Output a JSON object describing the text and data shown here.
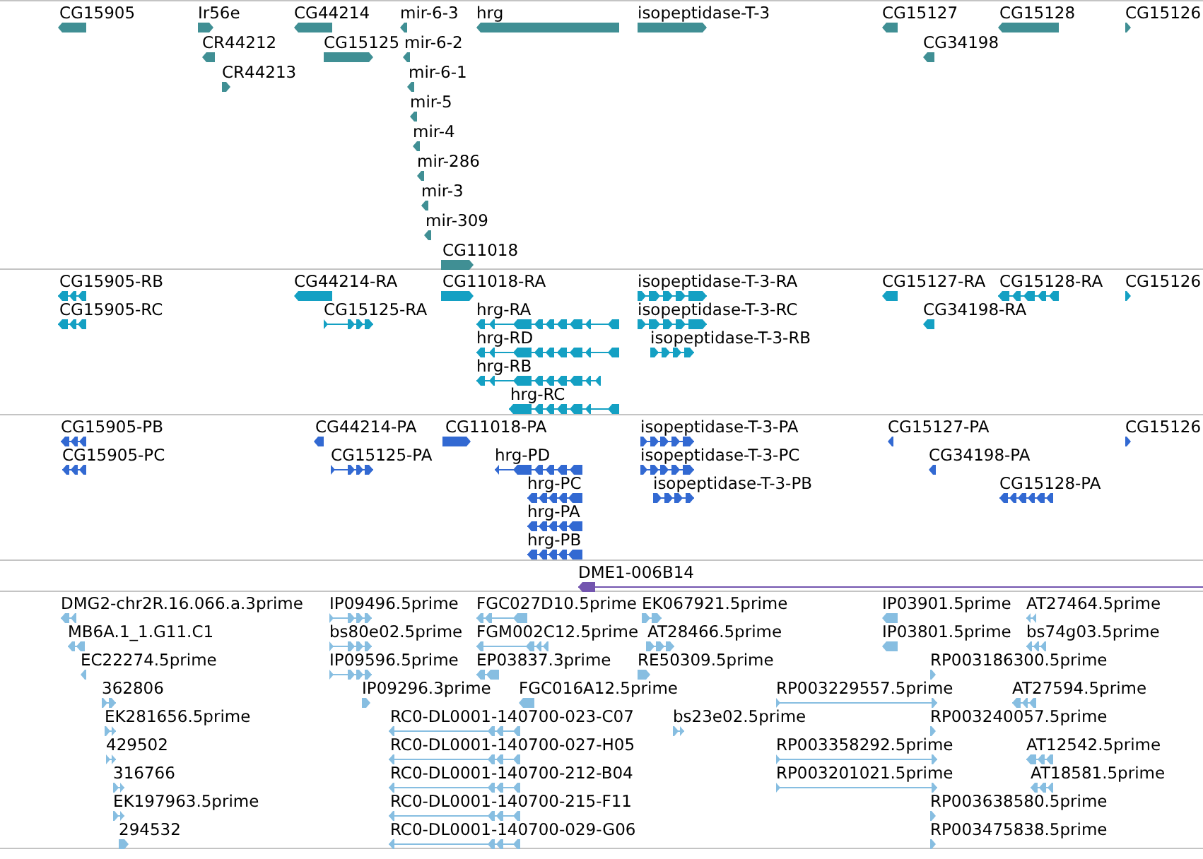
{
  "tracks": [
    {
      "color": "#408f94",
      "features": [
        {
          "label": "CG15905",
          "reverse": true
        },
        {
          "label": "Ir56e",
          "reverse": false
        },
        {
          "label": "CG44214",
          "reverse": true
        },
        {
          "label": "mir-6-3",
          "reverse": true
        },
        {
          "label": "hrg",
          "reverse": true
        },
        {
          "label": "isopeptidase-T-3",
          "reverse": false
        },
        {
          "label": "CG15127",
          "reverse": true
        },
        {
          "label": "CG15128",
          "reverse": true
        },
        {
          "label": "CG15126",
          "reverse": false
        },
        {
          "label": "CR44212",
          "reverse": true
        },
        {
          "label": "CG15125",
          "reverse": false
        },
        {
          "label": "mir-6-2",
          "reverse": true
        },
        {
          "label": "CG34198",
          "reverse": true
        },
        {
          "label": "CR44213",
          "reverse": false
        },
        {
          "label": "mir-6-1",
          "reverse": true
        },
        {
          "label": "mir-5",
          "reverse": true
        },
        {
          "label": "mir-4",
          "reverse": true
        },
        {
          "label": "mir-286",
          "reverse": true
        },
        {
          "label": "mir-3",
          "reverse": true
        },
        {
          "label": "mir-309",
          "reverse": true
        },
        {
          "label": "CG11018",
          "reverse": false
        }
      ]
    },
    {
      "color": "#14a0c3",
      "features": [
        {
          "label": "CG15905-RB",
          "reverse": true
        },
        {
          "label": "CG44214-RA",
          "reverse": true
        },
        {
          "label": "CG11018-RA",
          "reverse": false
        },
        {
          "label": "isopeptidase-T-3-RA",
          "reverse": false
        },
        {
          "label": "CG15127-RA",
          "reverse": true
        },
        {
          "label": "CG15128-RA",
          "reverse": true
        },
        {
          "label": "CG15126",
          "reverse": false
        },
        {
          "label": "CG15905-RC",
          "reverse": true
        },
        {
          "label": "CG15125-RA",
          "reverse": false
        },
        {
          "label": "hrg-RA",
          "reverse": true
        },
        {
          "label": "isopeptidase-T-3-RC",
          "reverse": false
        },
        {
          "label": "CG34198-RA",
          "reverse": true
        },
        {
          "label": "hrg-RD",
          "reverse": true
        },
        {
          "label": "isopeptidase-T-3-RB",
          "reverse": false
        },
        {
          "label": "hrg-RB",
          "reverse": true
        },
        {
          "label": "hrg-RC",
          "reverse": true
        }
      ]
    },
    {
      "color": "#3269d2",
      "features": [
        {
          "label": "CG15905-PB",
          "reverse": true
        },
        {
          "label": "CG44214-PA",
          "reverse": true
        },
        {
          "label": "CG11018-PA",
          "reverse": false
        },
        {
          "label": "isopeptidase-T-3-PA",
          "reverse": false
        },
        {
          "label": "CG15127-PA",
          "reverse": true
        },
        {
          "label": "CG15126",
          "reverse": false
        },
        {
          "label": "CG15905-PC",
          "reverse": true
        },
        {
          "label": "CG15125-PA",
          "reverse": false
        },
        {
          "label": "hrg-PD",
          "reverse": true
        },
        {
          "label": "isopeptidase-T-3-PC",
          "reverse": false
        },
        {
          "label": "CG34198-PA",
          "reverse": true
        },
        {
          "label": "hrg-PC",
          "reverse": true
        },
        {
          "label": "isopeptidase-T-3-PB",
          "reverse": false
        },
        {
          "label": "CG15128-PA",
          "reverse": true
        },
        {
          "label": "hrg-PA",
          "reverse": true
        },
        {
          "label": "hrg-PB",
          "reverse": true
        }
      ]
    },
    {
      "color": "#7355af",
      "features": [
        {
          "label": "DME1-006B14",
          "reverse": true
        }
      ]
    },
    {
      "color": "#87bee1",
      "features": [
        {
          "label": "DMG2-chr2R.16.066.a.3prime",
          "reverse": true
        },
        {
          "label": "IP09496.5prime",
          "reverse": false
        },
        {
          "label": "FGC027D10.5prime",
          "reverse": true
        },
        {
          "label": "EK067921.5prime",
          "reverse": false
        },
        {
          "label": "IP03901.5prime",
          "reverse": true
        },
        {
          "label": "AT27464.5prime",
          "reverse": true
        },
        {
          "label": "MB6A.1_1.G11.C1",
          "reverse": true
        },
        {
          "label": "bs80e02.5prime",
          "reverse": false
        },
        {
          "label": "FGM002C12.5prime",
          "reverse": true
        },
        {
          "label": "AT28466.5prime",
          "reverse": false
        },
        {
          "label": "IP03801.5prime",
          "reverse": true
        },
        {
          "label": "bs74g03.5prime",
          "reverse": true
        },
        {
          "label": "EC22274.5prime",
          "reverse": true
        },
        {
          "label": "IP09596.5prime",
          "reverse": false
        },
        {
          "label": "EP03837.3prime",
          "reverse": true
        },
        {
          "label": "RE50309.5prime",
          "reverse": false
        },
        {
          "label": "RP003186300.5prime",
          "reverse": false
        },
        {
          "label": "362806",
          "reverse": false
        },
        {
          "label": "IP09296.3prime",
          "reverse": false
        },
        {
          "label": "FGC016A12.5prime",
          "reverse": true
        },
        {
          "label": "RP003229557.5prime",
          "reverse": false
        },
        {
          "label": "AT27594.5prime",
          "reverse": true
        },
        {
          "label": "EK281656.5prime",
          "reverse": false
        },
        {
          "label": "RC0-DL0001-140700-023-C07",
          "reverse": true
        },
        {
          "label": "bs23e02.5prime",
          "reverse": false
        },
        {
          "label": "RP003240057.5prime",
          "reverse": false
        },
        {
          "label": "429502",
          "reverse": false
        },
        {
          "label": "RC0-DL0001-140700-027-H05",
          "reverse": true
        },
        {
          "label": "RP003358292.5prime",
          "reverse": false
        },
        {
          "label": "AT12542.5prime",
          "reverse": true
        },
        {
          "label": "316766",
          "reverse": false
        },
        {
          "label": "RC0-DL0001-140700-212-B04",
          "reverse": true
        },
        {
          "label": "RP003201021.5prime",
          "reverse": false
        },
        {
          "label": "AT18581.5prime",
          "reverse": true
        },
        {
          "label": "EK197963.5prime",
          "reverse": false
        },
        {
          "label": "RC0-DL0001-140700-215-F11",
          "reverse": true
        },
        {
          "label": "RP003638580.5prime",
          "reverse": false
        },
        {
          "label": "294532",
          "reverse": false
        },
        {
          "label": "RC0-DL0001-140700-029-G06",
          "reverse": true
        },
        {
          "label": "RP003475838.5prime",
          "reverse": false
        }
      ]
    }
  ]
}
